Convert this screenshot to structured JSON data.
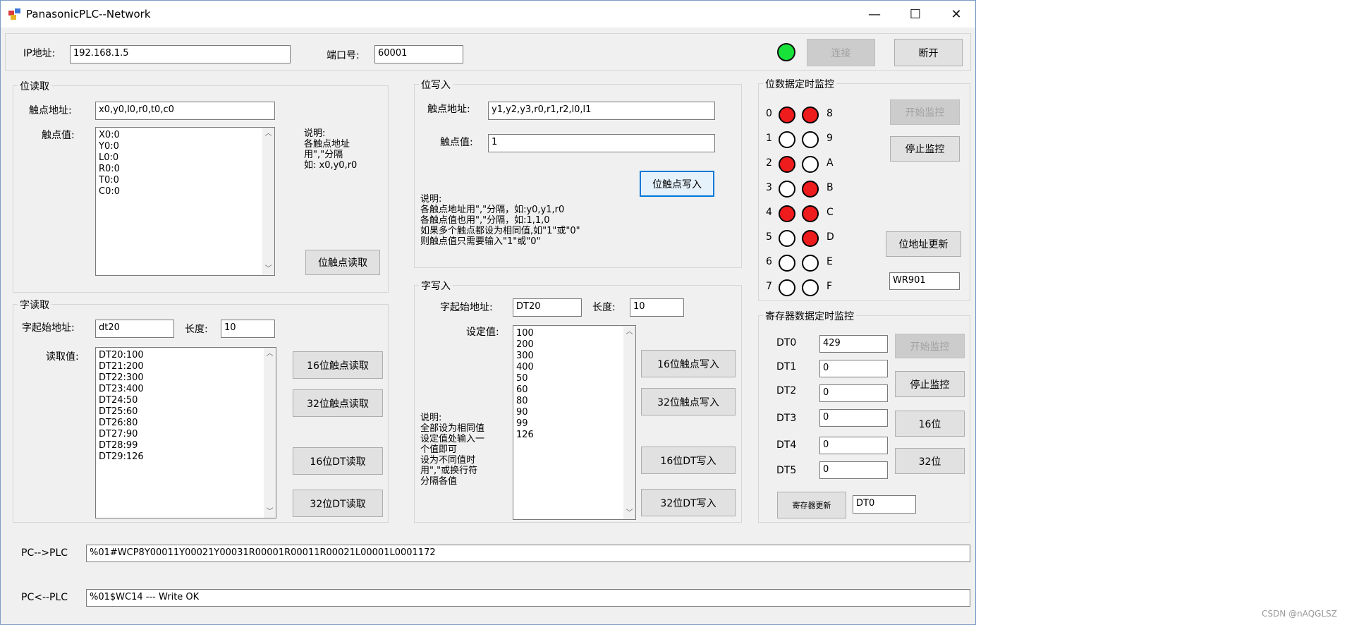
{
  "window": {
    "title": "PanasonicPLC--Network",
    "controls": {
      "minimize": "—",
      "maximize": "☐",
      "close": "✕"
    }
  },
  "connection": {
    "ip_label": "IP地址:",
    "ip_value": "192.168.1.5",
    "port_label": "端口号:",
    "port_value": "60001",
    "status_color": "#18e23a",
    "connect_label": "连接",
    "disconnect_label": "断开"
  },
  "bit_read": {
    "title": "位读取",
    "addr_label": "触点地址:",
    "addr_value": "x0,y0,l0,r0,t0,c0",
    "value_label": "触点值:",
    "values": [
      "X0:0",
      "Y0:0",
      "L0:0",
      "R0:0",
      "T0:0",
      "C0:0"
    ],
    "note": [
      "说明:",
      "各触点地址",
      "用\",\"分隔",
      "如: x0,y0,r0"
    ],
    "read_button": "位触点读取"
  },
  "bit_write": {
    "title": "位写入",
    "addr_label": "触点地址:",
    "addr_value": "y1,y2,y3,r0,r1,r2,l0,l1",
    "value_label": "触点值:",
    "value_value": "1",
    "write_button": "位触点写入",
    "note": [
      "说明:",
      "各触点地址用\",\"分隔，如:y0,y1,r0",
      "各触点值也用\",\"分隔，如:1,1,0",
      "如果多个触点都设为相同值,如\"1\"或\"0\"",
      "则触点值只需要输入\"1\"或\"0\""
    ]
  },
  "bit_monitor": {
    "title": "位数据定时监控",
    "left_labels": [
      "0",
      "1",
      "2",
      "3",
      "4",
      "5",
      "6",
      "7"
    ],
    "right_labels": [
      "8",
      "9",
      "A",
      "B",
      "C",
      "D",
      "E",
      "F"
    ],
    "left_states": [
      1,
      0,
      1,
      0,
      1,
      0,
      0,
      0
    ],
    "right_states": [
      1,
      0,
      0,
      1,
      1,
      1,
      0,
      0
    ],
    "on_color": "#ee1c1c",
    "start_button": "开始监控",
    "stop_button": "停止监控",
    "update_button": "位地址更新",
    "addr_value": "WR901"
  },
  "word_read": {
    "title": "字读取",
    "start_label": "字起始地址:",
    "start_value": "dt20",
    "length_label": "长度:",
    "length_value": "10",
    "value_label": "读取值:",
    "values": [
      "DT20:100",
      "DT21:200",
      "DT22:300",
      "DT23:400",
      "DT24:50",
      "DT25:60",
      "DT26:80",
      "DT27:90",
      "DT28:99",
      "DT29:126"
    ],
    "btn_16_contact": "16位触点读取",
    "btn_32_contact": "32位触点读取",
    "btn_16_dt": "16位DT读取",
    "btn_32_dt": "32位DT读取"
  },
  "word_write": {
    "title": "字写入",
    "start_label": "字起始地址:",
    "start_value": "DT20",
    "length_label": "长度:",
    "length_value": "10",
    "value_label": "设定值:",
    "values": [
      "100",
      "200",
      "300",
      "400",
      "50",
      "60",
      "80",
      "90",
      "99",
      "126"
    ],
    "note": [
      "说明:",
      "全部设为相同值",
      "设定值处输入一",
      "个值即可",
      "设为不同值时",
      "用\",\"或换行符",
      "分隔各值"
    ],
    "btn_16_contact": "16位触点写入",
    "btn_32_contact": "32位触点写入",
    "btn_16_dt": "16位DT写入",
    "btn_32_dt": "32位DT写入"
  },
  "reg_monitor": {
    "title": "寄存器数据定时监控",
    "rows": [
      {
        "label": "DT0",
        "value": "429"
      },
      {
        "label": "DT1",
        "value": "0"
      },
      {
        "label": "DT2",
        "value": "0"
      },
      {
        "label": "DT3",
        "value": "0"
      },
      {
        "label": "DT4",
        "value": "0"
      },
      {
        "label": "DT5",
        "value": "0"
      }
    ],
    "start_button": "开始监控",
    "stop_button": "停止监控",
    "btn_16": "16位",
    "btn_32": "32位",
    "update_button": "寄存器更新",
    "addr_value": "DT0"
  },
  "log": {
    "send_label": "PC-->PLC",
    "send_value": "%01#WCP8Y00011Y00021Y00031R00001R00011R00021L00001L0001172",
    "recv_label": "PC<--PLC",
    "recv_value": "%01$WC14 --- Write OK"
  },
  "watermark": "CSDN @nAQGLSZ"
}
